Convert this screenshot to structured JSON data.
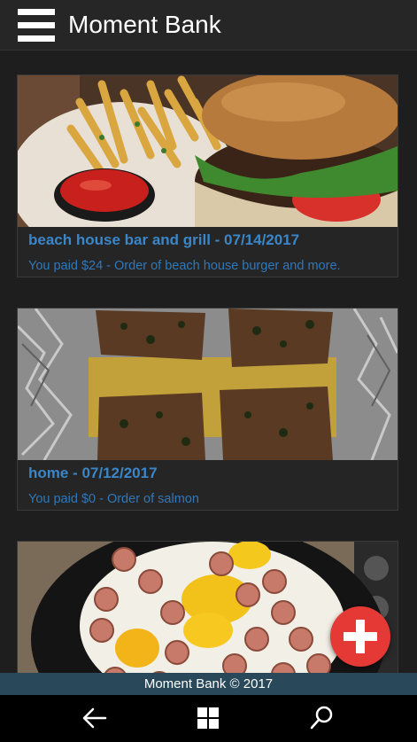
{
  "app": {
    "title": "Moment Bank"
  },
  "cards": [
    {
      "title": "beach house bar and grill - 07/14/2017",
      "description": "You paid $24 - Order of beach house burger and more."
    },
    {
      "title": "home - 07/12/2017",
      "description": "You paid $0 - Order of salmon"
    },
    {
      "title": "",
      "description": ""
    }
  ],
  "footer": {
    "text": "Moment Bank © 2017"
  },
  "colors": {
    "accent": "#3a86c8",
    "fab": "#e53935",
    "footer_bg": "#29495a",
    "appbar_bg": "#262626"
  },
  "icons": {
    "menu": "hamburger-icon",
    "add": "plus-icon",
    "back": "back-arrow-icon",
    "start": "windows-icon",
    "search": "search-icon"
  }
}
